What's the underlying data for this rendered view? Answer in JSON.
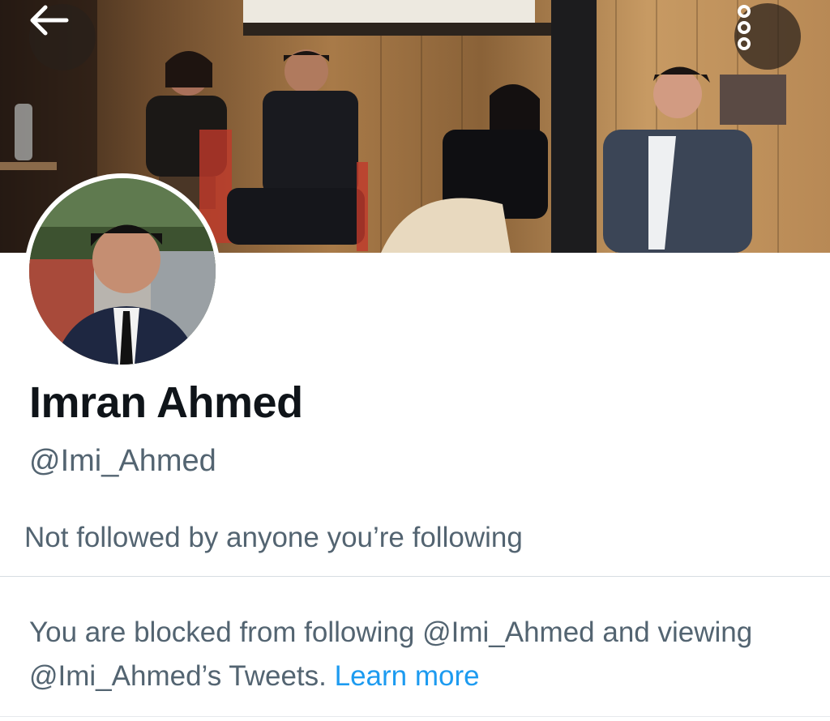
{
  "profile": {
    "display_name": "Imran Ahmed",
    "handle": "@Imi_Ahmed",
    "followers_note": "Not followed by anyone you’re following"
  },
  "blocked_notice": {
    "text": "You are blocked from following @Imi_Ahmed and viewing @Imi_Ahmed’s Tweets.",
    "link_label": "Learn more"
  },
  "icons": {
    "back": "arrow-left-icon",
    "more": "more-vertical-icon"
  },
  "colors": {
    "text_primary": "#0f1419",
    "text_secondary": "#536471",
    "link": "#1d9bf0",
    "divider": "#d7dde2"
  }
}
